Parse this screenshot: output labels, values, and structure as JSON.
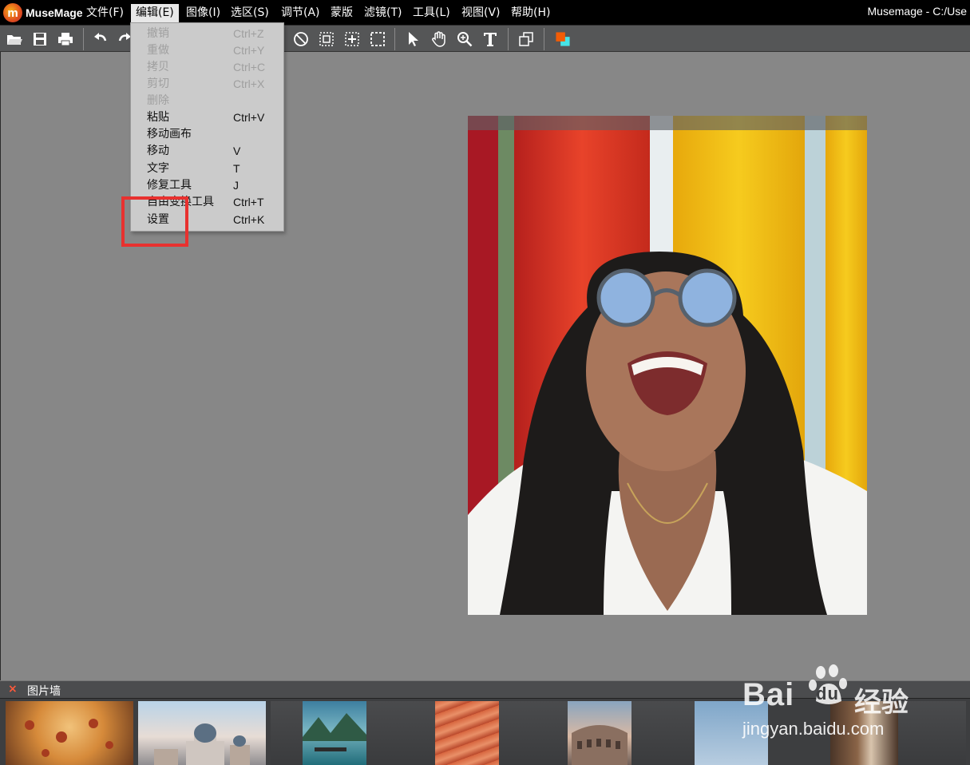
{
  "app": {
    "name": "MuseMage",
    "logo_letter": "m",
    "window_title": "Musemage - C:/Use"
  },
  "menubar": {
    "items": [
      {
        "label": "文件(F)"
      },
      {
        "label": "编辑(E)"
      },
      {
        "label": "图像(I)"
      },
      {
        "label": "选区(S)"
      },
      {
        "label": "调节(A)"
      },
      {
        "label": "蒙版"
      },
      {
        "label": "滤镜(T)"
      },
      {
        "label": "工具(L)"
      },
      {
        "label": "视图(V)"
      },
      {
        "label": "帮助(H)"
      }
    ],
    "active_index": 1
  },
  "toolbar": {
    "icons": [
      "open-folder-icon",
      "save-icon",
      "print-icon",
      "undo-icon",
      "redo-icon",
      "deselect-icon",
      "select-rect-icon",
      "select-move-icon",
      "select-dashed-icon",
      "pointer-icon",
      "hand-icon",
      "zoom-icon",
      "text-tool-icon",
      "layers-copy-icon",
      "color-swatch-icon"
    ],
    "foreground_color": "#f25c05",
    "background_color": "#46e3e6"
  },
  "edit_menu": {
    "items": [
      {
        "label": "撤销",
        "shortcut": "Ctrl+Z",
        "enabled": false
      },
      {
        "label": "重做",
        "shortcut": "Ctrl+Y",
        "enabled": false
      },
      {
        "label": "拷贝",
        "shortcut": "Ctrl+C",
        "enabled": false
      },
      {
        "label": "剪切",
        "shortcut": "Ctrl+X",
        "enabled": false
      },
      {
        "label": "删除",
        "shortcut": "",
        "enabled": false
      },
      {
        "label": "粘贴",
        "shortcut": "Ctrl+V",
        "enabled": true
      },
      {
        "label": "移动画布",
        "shortcut": "",
        "enabled": true
      },
      {
        "label": "移动",
        "shortcut": "V",
        "enabled": true
      },
      {
        "label": "文字",
        "shortcut": "T",
        "enabled": true
      },
      {
        "label": "修复工具",
        "shortcut": "J",
        "enabled": true
      },
      {
        "label": "自由变换工具",
        "shortcut": "Ctrl+T",
        "enabled": true
      },
      {
        "label": "设置",
        "shortcut": "Ctrl+K",
        "enabled": true
      }
    ]
  },
  "photo_wall": {
    "close_glyph": "×",
    "title": "图片墙",
    "thumbnails": [
      "pizza",
      "venice-church",
      "lake-boat",
      "canyon",
      "colosseum",
      "sky",
      "cathedral"
    ]
  },
  "watermark": {
    "logo": "Bai",
    "logo_suffix": "du",
    "text": "经验",
    "url": "jingyan.baidu.com"
  },
  "colors": {
    "menubar_bg": "#000000",
    "toolbar_bg": "#555657",
    "canvas_bg": "#878787",
    "dropdown_bg": "#cbcbcb",
    "highlight": "#e8312f"
  }
}
